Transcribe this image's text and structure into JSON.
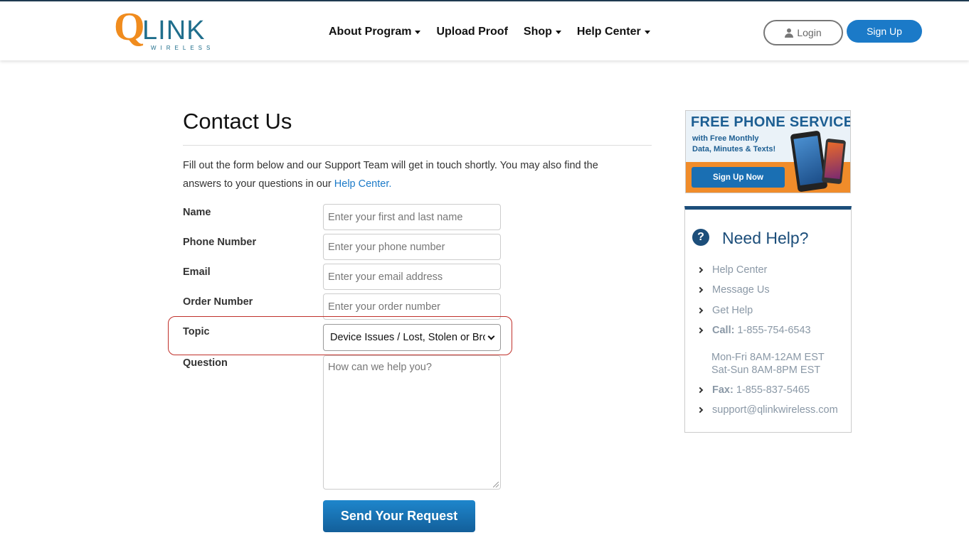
{
  "header": {
    "logo": {
      "main": "LINK",
      "q": "Q",
      "sub": "WIRELESS"
    },
    "nav": [
      {
        "label": "About Program",
        "dropdown": true
      },
      {
        "label": "Upload Proof",
        "dropdown": false
      },
      {
        "label": "Shop",
        "dropdown": true
      },
      {
        "label": "Help Center",
        "dropdown": true
      }
    ],
    "login_label": "Login",
    "signup_label": "Sign Up"
  },
  "main": {
    "title": "Contact Us",
    "intro_text": "Fill out the form below and our Support Team will get in touch shortly. You may also find the answers to your questions in our ",
    "intro_link": "Help Center.",
    "form": {
      "name_label": "Name",
      "name_placeholder": "Enter your first and last name",
      "phone_label": "Phone Number",
      "phone_placeholder": "Enter your phone number",
      "email_label": "Email",
      "email_placeholder": "Enter your email address",
      "order_label": "Order Number",
      "order_placeholder": "Enter your order number",
      "topic_label": "Topic",
      "topic_selected": "Device Issues / Lost, Stolen or Broken",
      "question_label": "Question",
      "question_placeholder": "How can we help you?",
      "submit_label": "Send Your Request"
    }
  },
  "sidebar": {
    "ad": {
      "title": "FREE PHONE SERVICE",
      "subtitle_line1": "with Free Monthly",
      "subtitle_line2": "Data, Minutes & Texts!",
      "button": "Sign Up Now"
    },
    "help": {
      "icon": "question-circle-icon",
      "title": "Need Help?",
      "links": {
        "help_center": "Help Center",
        "message_us": "Message Us",
        "get_help": "Get Help",
        "call_label": "Call:",
        "call_number": "1-855-754-6543",
        "hours_weekday": "Mon-Fri 8AM-12AM EST",
        "hours_weekend": "Sat-Sun 8AM-8PM EST",
        "fax_label": "Fax:",
        "fax_number": "1-855-837-5465",
        "email": "support@qlinkwireless.com"
      }
    }
  },
  "colors": {
    "brand_orange": "#f08c1e",
    "brand_blue": "#1b7ac8",
    "navy": "#1c4e7a",
    "highlight_red": "#c0302a"
  }
}
